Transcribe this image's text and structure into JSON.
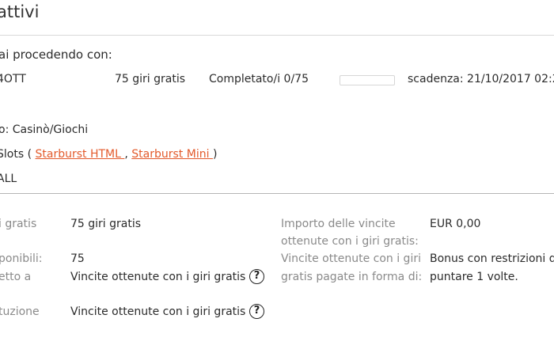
{
  "header": {
    "title": "attivi"
  },
  "promo": {
    "intro": "ai procedendo con:",
    "code": "4OTT",
    "free_spins": "75 giri gratis",
    "completed": "Completato/i 0/75",
    "progress_fraction": 0,
    "expiry": "scadenza: 21/10/2017 02:2"
  },
  "details": {
    "category": "o: Casinò/Giochi",
    "slots_prefix": "Slots ( ",
    "slots_link_1": "Starburst HTML ",
    "slots_separator": ", ",
    "slots_link_2": "Starburst Mini ",
    "slots_suffix": ")",
    "platform": "ALL"
  },
  "table": {
    "row1": {
      "label": "i gratis",
      "value": "75 giri gratis",
      "label_right_line1": "Importo delle vincite",
      "label_right_line2": "ottenute con i giri gratis:",
      "value_right": "EUR 0,00"
    },
    "row2": {
      "label_line1": "ponibili:",
      "label_line2": "etto a",
      "value_line1": "75",
      "value_line2": "Vincite ottenute con i giri gratis",
      "label_right_line1": "Vincite ottenute con i giri",
      "label_right_line2": "gratis pagate in forma di:",
      "value_right_line1": "Bonus con restrizioni d",
      "value_right_line2": "puntare 1 volte."
    },
    "row3": {
      "label": "tuzione",
      "value": "Vincite ottenute con i giri gratis"
    },
    "help_glyph": "?"
  },
  "icons": {
    "help": "question-circle-icon"
  },
  "colors": {
    "link": "#e35a2b",
    "label": "#8a8a8a",
    "text": "#2b2b2b"
  }
}
